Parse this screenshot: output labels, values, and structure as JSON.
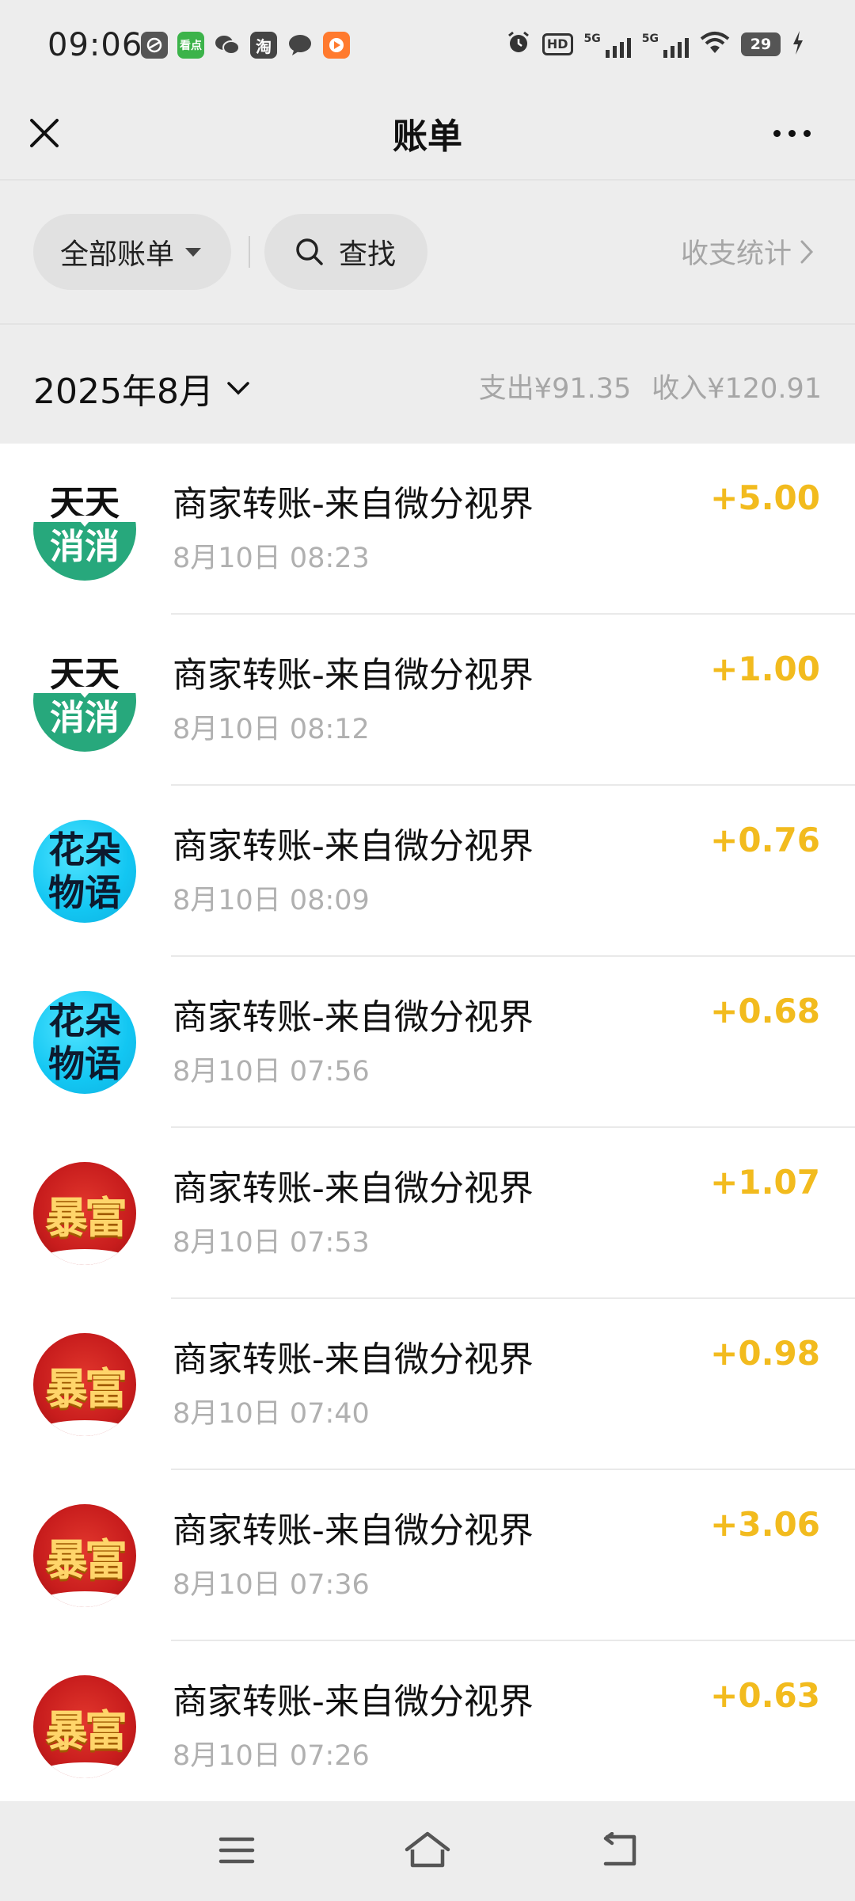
{
  "status_bar": {
    "time": "09:06",
    "apps": [
      {
        "icon": "browser-icon",
        "label": "",
        "color": "#444444"
      },
      {
        "icon": "kandian-icon",
        "label": "看点",
        "color": "#3cb34a"
      },
      {
        "icon": "wechat-icon",
        "label": "",
        "color": "#444444"
      },
      {
        "icon": "taobao-icon",
        "label": "淘",
        "color": "#444444"
      },
      {
        "icon": "message-icon",
        "label": "",
        "color": "#444444"
      },
      {
        "icon": "video-app-icon",
        "label": "",
        "color": "#ff7a2e"
      }
    ],
    "hd_label": "HD",
    "network_1": "5G",
    "network_2": "5G",
    "battery": "29"
  },
  "nav": {
    "title": "账单"
  },
  "filter": {
    "all_bills": "全部账单",
    "search": "查找",
    "stats": "收支统计"
  },
  "month": {
    "label": "2025年8月",
    "expense": "支出¥91.35",
    "income": "收入¥120.91"
  },
  "transactions": [
    {
      "avatar": "tiantian",
      "avatar_top": "天天",
      "avatar_bottom": "消消",
      "title": "商家转账-来自微分视界",
      "time": "8月10日 08:23",
      "amount": "+5.00"
    },
    {
      "avatar": "tiantian",
      "avatar_top": "天天",
      "avatar_bottom": "消消",
      "title": "商家转账-来自微分视界",
      "time": "8月10日 08:12",
      "amount": "+1.00"
    },
    {
      "avatar": "huaduo",
      "avatar_top": "花朵",
      "avatar_bottom": "物语",
      "title": "商家转账-来自微分视界",
      "time": "8月10日 08:09",
      "amount": "+0.76"
    },
    {
      "avatar": "huaduo",
      "avatar_top": "花朵",
      "avatar_bottom": "物语",
      "title": "商家转账-来自微分视界",
      "time": "8月10日 07:56",
      "amount": "+0.68"
    },
    {
      "avatar": "baofu",
      "avatar_text": "暴富",
      "title": "商家转账-来自微分视界",
      "time": "8月10日 07:53",
      "amount": "+1.07"
    },
    {
      "avatar": "baofu",
      "avatar_text": "暴富",
      "title": "商家转账-来自微分视界",
      "time": "8月10日 07:40",
      "amount": "+0.98"
    },
    {
      "avatar": "baofu",
      "avatar_text": "暴富",
      "title": "商家转账-来自微分视界",
      "time": "8月10日 07:36",
      "amount": "+3.06"
    },
    {
      "avatar": "baofu",
      "avatar_text": "暴富",
      "title": "商家转账-来自微分视界",
      "time": "8月10日 07:26",
      "amount": "+0.63"
    }
  ],
  "colors": {
    "amount": "#f2bb1e",
    "page_bg": "#ededed",
    "secondary_text": "#a6a6a6"
  }
}
